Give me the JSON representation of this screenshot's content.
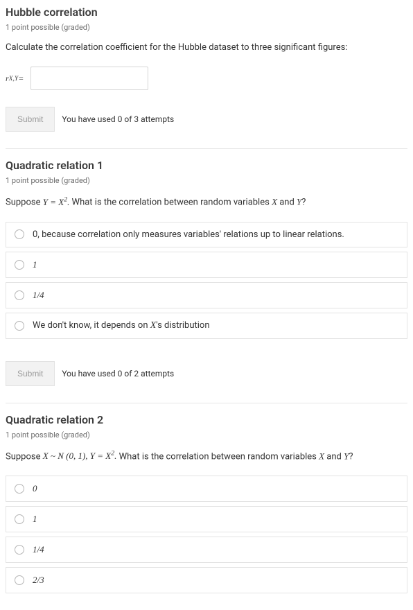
{
  "p1": {
    "title": "Hubble correlation",
    "points": "1 point possible (graded)",
    "instr": "Calculate the correlation coefficient for the Hubble dataset to three significant figures:",
    "label_html": "r<sub>X,Y</sub> <span class='up'>=</span>",
    "input_value": "",
    "submit": "Submit",
    "attempts": "You have used 0 of 3 attempts"
  },
  "p2": {
    "title": "Quadratic relation 1",
    "points": "1 point possible (graded)",
    "instr_pre": "Suppose ",
    "instr_math": "Y = X<sup>2</sup>.",
    "instr_mid": " What is the correlation between random variables ",
    "instr_x": "X",
    "instr_and": " and ",
    "instr_y": "Y",
    "instr_q": "?",
    "choices": [
      "0, because correlation only measures variables' relations up to linear relations.",
      "1",
      "1/4",
      "We don't know, it depends on <span class='math'>X</span>'s distribution"
    ],
    "submit": "Submit",
    "attempts": "You have used 0 of 2 attempts"
  },
  "p3": {
    "title": "Quadratic relation 2",
    "points": "1 point possible (graded)",
    "instr_pre": "Suppose ",
    "instr_math": "X ~ <span class='script'>N</span> (0, 1), Y = X<sup>2</sup>.",
    "instr_mid": " What is the correlation between random variables ",
    "instr_x": "X",
    "instr_and": " and ",
    "instr_y": "Y",
    "instr_q": "?",
    "choices": [
      "0",
      "1",
      "1/4",
      "2/3"
    ]
  }
}
